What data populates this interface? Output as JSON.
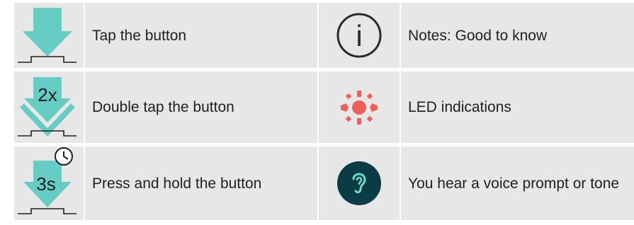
{
  "colors": {
    "background": "#e7e7e8",
    "arrow": "#66cdc5",
    "led": "#ef5f5a",
    "ear_badge": "#0b3c43",
    "ear_glyph": "#6fd6cc",
    "text": "#1f1f1f"
  },
  "rows": [
    {
      "left_icon": "tap-arrow-icon",
      "left_text": "Tap the button",
      "right_icon": "info-icon",
      "right_icon_glyph": "i",
      "right_text": "Notes: Good to know"
    },
    {
      "left_icon": "double-tap-arrow-icon",
      "left_icon_label": "2x",
      "left_text": "Double tap the button",
      "right_icon": "led-icon",
      "right_text": "LED indications"
    },
    {
      "left_icon": "press-hold-arrow-icon",
      "left_icon_label": "3s",
      "left_text": "Press and hold the button",
      "right_icon": "voice-prompt-ear-icon",
      "right_text": "You hear a voice prompt or tone"
    }
  ]
}
